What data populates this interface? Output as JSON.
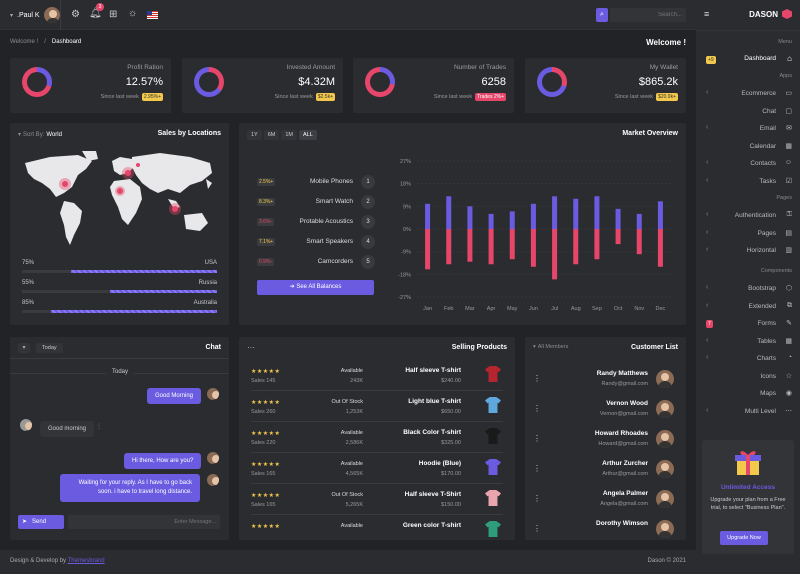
{
  "topbar": {
    "user": ".Paul K",
    "notif_count": "3",
    "search_placeholder": "Search..."
  },
  "breadcrumb": {
    "home": "Welcome !",
    "current": "Dashboard"
  },
  "page_title": "Welcome !",
  "stats": [
    {
      "label": "Profit Ration",
      "value": "12.57%",
      "since": "Since last week",
      "badge": "2.95%+",
      "badge_color": "#f2c94c"
    },
    {
      "label": "Invested Amount",
      "value": "$4.32M",
      "since": "Since last week",
      "badge": "$2.5k+",
      "badge_color": "#f2c94c"
    },
    {
      "label": "Number of Trades",
      "value": "6258",
      "since": "Since last week",
      "badge": "Trades 2%+",
      "badge_color": "#e5466a"
    },
    {
      "label": "My Wallet",
      "value": "$865.2k",
      "since": "Since last week",
      "badge": "$20.9k+",
      "badge_color": "#f2c94c"
    }
  ],
  "sales_locations": {
    "sort_by": "Sort By:",
    "sort_value": "World",
    "title": "Sales by Locations",
    "rows": [
      {
        "pct": "75%",
        "name": "USA",
        "fill": 0.75
      },
      {
        "pct": "55%",
        "name": "Russia",
        "fill": 0.55
      },
      {
        "pct": "85%",
        "name": "Australia",
        "fill": 0.85
      }
    ]
  },
  "market": {
    "title": "Market Overview",
    "ranges": [
      "1Y",
      "6M",
      "1M",
      "ALL"
    ],
    "items": [
      {
        "badge": "2.5%+",
        "badge_color": "#f2c94c",
        "name": "Mobile Phones",
        "n": "1"
      },
      {
        "badge": "8.3%+",
        "badge_color": "#f2c94c",
        "name": "Smart Watch",
        "n": "2"
      },
      {
        "badge": "3.6%-",
        "badge_color": "#e5466a",
        "name": "Protable Acoustics",
        "n": "3"
      },
      {
        "badge": "7.1%+",
        "badge_color": "#f2c94c",
        "name": "Smart Speakers",
        "n": "4"
      },
      {
        "badge": "0.9%-",
        "badge_color": "#e5466a",
        "name": "Camcorders",
        "n": "5"
      }
    ],
    "button": "See All Balances"
  },
  "chart_data": {
    "type": "bar",
    "categories": [
      "Jan",
      "Feb",
      "Mar",
      "Apr",
      "May",
      "Jun",
      "Jul",
      "Aug",
      "Sep",
      "Oct",
      "Nov",
      "Dec"
    ],
    "series": [
      {
        "values": [
          10,
          13,
          9,
          6,
          7,
          10,
          13,
          12,
          13,
          8,
          6,
          11
        ],
        "color": "#6b5be0"
      },
      {
        "values": [
          -16,
          -14,
          -13,
          -14,
          -12,
          -15,
          -20,
          -14,
          -12,
          -6,
          -10,
          -15
        ],
        "color": "#e5466a"
      }
    ],
    "yticks": [
      "27%",
      "18%",
      "9%",
      "0%",
      "-9%",
      "-18%",
      "-27%"
    ],
    "ylim": [
      -27,
      27
    ]
  },
  "chat": {
    "filter": "Today",
    "title": "Chat",
    "day": "Today",
    "messages": [
      {
        "text": "Good Morning",
        "side": "right"
      },
      {
        "text": "Good morning",
        "side": "left"
      },
      {
        "text": "Hi there, How are you?",
        "side": "right"
      },
      {
        "text": "Waiting for your reply. As I have to go back soon. i have to travel long distance.",
        "side": "right"
      }
    ],
    "input_placeholder": "Enter Message...",
    "send": "Send"
  },
  "products": {
    "title": "Selling Products",
    "rows": [
      {
        "sales": "Sales 145",
        "status": "Available",
        "amount": "243K",
        "name": "Half sleeve T-shirt",
        "price": "$240.00",
        "color": "#b5252f"
      },
      {
        "sales": "Sales 260",
        "status": "Out Of Stock",
        "amount": "1,253K",
        "name": "Light blue T-shirt",
        "price": "$650.00",
        "color": "#5fa8de"
      },
      {
        "sales": "Sales 220",
        "status": "Available",
        "amount": "2,586K",
        "name": "Black Color T-shirt",
        "price": "$325.00",
        "color": "#1a1a1a"
      },
      {
        "sales": "Sales 165",
        "status": "Available",
        "amount": "4,565K",
        "name": "Hoodie (Blue)",
        "price": "$170.00",
        "color": "#6b5be0"
      },
      {
        "sales": "Sales 165",
        "status": "Out Of Stock",
        "amount": "5,265K",
        "name": "Half sleeve T-Shirt",
        "price": "$150.00",
        "color": "#e8a5b0"
      },
      {
        "sales": "",
        "status": "Available",
        "amount": "",
        "name": "Green color T-shirt",
        "price": "",
        "color": "#2e9e7a"
      }
    ],
    "stars": "★★★★★"
  },
  "members": {
    "filter": "All Members",
    "title": "Customer List",
    "rows": [
      {
        "name": "Randy Matthews",
        "email": "Randy@gmail.com"
      },
      {
        "name": "Vernon Wood",
        "email": "Vernon@gmail.com"
      },
      {
        "name": "Howard Rhoades",
        "email": "Howard@gmail.com"
      },
      {
        "name": "Arthur Zurcher",
        "email": "Arthur@gmail.com"
      },
      {
        "name": "Angela Palmer",
        "email": "Angela@gmail.com"
      },
      {
        "name": "Dorothy Wimson",
        "email": ""
      }
    ]
  },
  "sidebar": {
    "logo": "DASON",
    "menu_head": "Menu",
    "dashboard": "Dashboard",
    "dashboard_badge": "+9",
    "apps_head": "Apps",
    "apps": [
      "Ecommerce",
      "Chat",
      "Email",
      "Calendar",
      "Contacts",
      "Tasks"
    ],
    "pages_head": "Pages",
    "pages": [
      "Authentication",
      "Pages",
      "Horizontal"
    ],
    "components_head": "Components",
    "components": [
      "Bootstrap",
      "Extended",
      "Forms",
      "Tables",
      "Charts",
      "Icons",
      "Maps",
      "Multi Level"
    ],
    "forms_badge": "7",
    "promo_title": "Unlimited Access",
    "promo_text": "Upgrade your plan from a Free trial, to select \"Business Plan\".",
    "promo_button": "Upgrade Now"
  },
  "footer": {
    "left": "Design & Develop by",
    "link": "Themesbrand",
    "right": "Dason © 2021"
  }
}
